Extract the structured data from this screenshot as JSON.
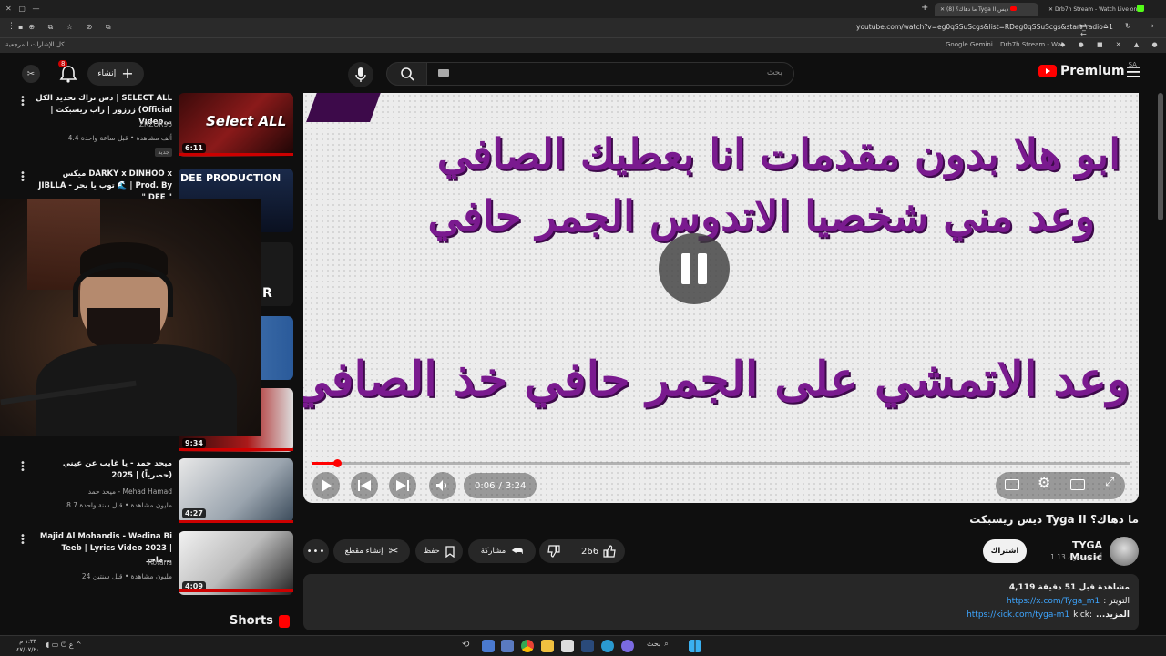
{
  "browser": {
    "tabs": [
      {
        "label": "(8) ما دهاك؟ Tyga II دیس",
        "active": true
      },
      {
        "label": "Drb7h Stream - Watch Live on",
        "active": false
      }
    ],
    "url": "youtube.com/watch?v=eg0qSSuScgs&list=RDeg0qSSuScgs&start_radio=1",
    "bookmarks_folder": "كل الإشارات المرجعية",
    "bookmark_items": [
      "Google Gemini",
      "Drb7h Stream - Wat..."
    ]
  },
  "header": {
    "logo_text": "Premium",
    "logo_region": "SA",
    "search_placeholder": "بحث",
    "create_label": "إنشاء",
    "notif_count": "8"
  },
  "sidebar": {
    "items": [
      {
        "title": "دس تراك تحديد الكل | SELECT ALL | زرزور | راب ريسبكت (Official Video...",
        "channel": "ZRZOR96",
        "meta": "4.4 ألف مشاهدة • قبل ساعة واحدة",
        "badge": "جديد",
        "duration": "6:11",
        "thumb_text": "Select ALL"
      },
      {
        "title": "ميكس DARKY x DINHOO x JIBLLA - توب يا بحر 🌊 | Prod. By \" DEE \"",
        "channel": "",
        "meta": "",
        "badge": "",
        "duration": "",
        "thumb_text": "DEE PRODUCTION"
      },
      {
        "title": "",
        "channel": "",
        "meta": "",
        "badge": "",
        "duration": "",
        "thumb_text": "R"
      },
      {
        "title": "",
        "channel": "",
        "meta": "",
        "badge": "",
        "duration": "9:34",
        "thumb_text": ""
      },
      {
        "title": "ميحد حمد - يا غايب عن عيني (حصرياً) | 2025",
        "channel": "ميحد حمد - Mehad Hamad",
        "meta": "8.7 مليون مشاهدة • قبل سنة واحدة",
        "badge": "",
        "duration": "4:27",
        "thumb_text": ""
      },
      {
        "title": "Majid Al Mohandis - Wedina Bi Teeb | Lyrics Video 2023 | ماجد...",
        "channel": "Rotana",
        "meta": "24 مليون مشاهدة • قبل سنتين",
        "badge": "",
        "duration": "4:09",
        "thumb_text": ""
      }
    ],
    "shorts_label": "Shorts"
  },
  "player": {
    "lyrics": [
      "ابو هلا بدون مقدمات انا بعطيك الصافي",
      "وعد مني شخصيا الاتدوس الجمر حافي",
      "وعد الاتمشي على الجمر حافي خذ الصافي"
    ],
    "time_current": "0:06",
    "time_total": "3:24",
    "progress": 0.03
  },
  "video": {
    "title": "ما دهاك؟ Tyga II دیس ريسبكت",
    "channel": "TYGA Music",
    "subscribers": "1.13 ألف مشترك",
    "subscribe_label": "اشتراك",
    "likes": "266",
    "share_label": "مشاركة",
    "save_label": "حفظ",
    "clip_label": "إنشاء مقطع"
  },
  "description": {
    "stats": "4,119 مشاهدة قبل 51 دقيقة",
    "line1_prefix": ": التويتر",
    "line1_link": "https://x.com/Tyga_m1",
    "line2_prefix": "kick:",
    "line2_link": "https://kick.com/tyga-m1",
    "more_label": "...المزيد"
  },
  "taskbar": {
    "search_label": "بحث",
    "clock_time": "١:٣٣ م",
    "clock_date": "٤٧/٠٧/٢٠"
  }
}
